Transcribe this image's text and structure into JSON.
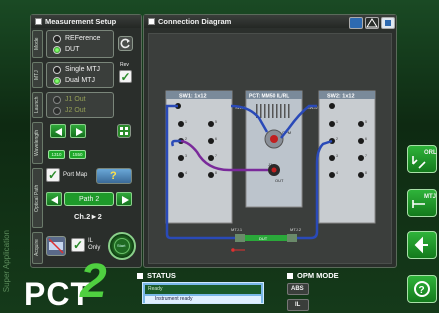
{
  "setup": {
    "title": "Measurement Setup",
    "mode_tab": "Mode",
    "mtj_tab": "MTJ",
    "launch_tab": "Launch",
    "wavelength_tab": "Wavelength",
    "optical_path_tab": "Optical Path",
    "acquire_tab": "Acquire",
    "mode_options": [
      "REFerence",
      "DUT"
    ],
    "mtj_options": [
      "Single MTJ",
      "Dual MTJ"
    ],
    "mtj_rev_label": "Rev",
    "launch_options": [
      "J1 Out",
      "J2 Out"
    ],
    "wavelengths": [
      "1310",
      "1550"
    ],
    "port_map_label": "Port Map",
    "port_map_value": "?",
    "path_value": "Path 2",
    "channel_value": "Ch.2►2",
    "il_only_label": "IL\nOnly",
    "start_label": "Start"
  },
  "diagram": {
    "title": "Connection Diagram",
    "sw1_label": "SW1: 1x12",
    "pct_label": "PCT: MM50 IL/RL",
    "sw2_label": "SW2: 1x12",
    "swj1": "SWJ1",
    "swj2": "SWJ2",
    "opm": "OPM",
    "j1": "J1",
    "out": "OUT",
    "mtj1": "MTJ.1",
    "mtj2": "MTJ.2",
    "dut": "DUT",
    "sw1_ports": [
      "1",
      "2",
      "3",
      "4",
      "5",
      "6",
      "7",
      "8"
    ],
    "sw2_ports": [
      "1",
      "2",
      "3",
      "4",
      "5",
      "6",
      "7",
      "8"
    ]
  },
  "status": {
    "title": "STATUS",
    "ready": "Ready",
    "message": "Instrument ready"
  },
  "opm": {
    "title": "OPM MODE",
    "abs": "ABS",
    "il": "IL"
  },
  "right": {
    "orl": "ORL",
    "mtj": "MTJ"
  },
  "brand": {
    "pct": "PCT",
    "two": "2",
    "super": "Super Application"
  }
}
